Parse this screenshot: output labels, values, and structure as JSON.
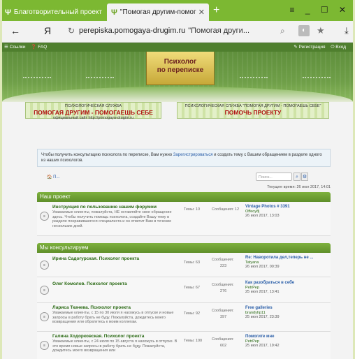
{
  "browser": {
    "tabs": [
      {
        "label": "Благотворительный проект"
      },
      {
        "label": "\"Помогая другим-помог"
      }
    ],
    "url_domain": "perepiska.pomogaya-drugim.ru",
    "url_title": "\"Помогая други..."
  },
  "topnav": {
    "links_label": "Ссылки",
    "faq_label": "FAQ",
    "register_label": "Регистрация",
    "login_label": "Вход"
  },
  "header": {
    "logo_line1": "Психолог",
    "logo_line2": "по переписке"
  },
  "banners": {
    "b1_small": "ПСИХОЛОГИЧЕСКАЯ СЛУЖБА",
    "b1_big": "ПОМОГАЯ ДРУГИМ - ПОМОГАЕШЬ СЕБЕ",
    "b1_site": "официальный сайт http://pomogaya-drugim.ru",
    "b2_small": "ПСИХОЛОГИЧЕСКАЯ СЛУЖБА \"ПОМОГАЯ ДРУГИМ - ПОМОГАЕШЬ СЕБЕ\"",
    "b2_big": "ПОМОЧЬ ПРОЕКТУ"
  },
  "notice": {
    "text_before": "Чтобы получить консультацию психолога по переписке, Вам нужно ",
    "link": "Зарегистрироваться",
    "text_after": " и создать тему с Вашим обращением в разделе одного из наших психологов."
  },
  "breadcrumb": {
    "home_label": "П..."
  },
  "search": {
    "placeholder": "Поиск..."
  },
  "time": "Текущее время: 26 июл 2017, 14:01",
  "sections": [
    {
      "title": "Наш проект",
      "forums": [
        {
          "title": "Инструкция по пользованию нашим форумом",
          "desc": "Уважаемые клиенты, пожалуйста, НЕ оставляйте свое обращение здесь. Чтобы получить помощь психолога, создайте Вашу тему в разделе понравившегося специалиста и он ответит Вам в течение нескольких дней.",
          "topics": "Темы: 10",
          "posts": "Сообщения: 12",
          "last_title": "Vintage Photos # 3391",
          "last_user": "Offeoy8j",
          "last_date": "26 июл 2017, 13:03"
        }
      ]
    },
    {
      "title": "Мы консультируем",
      "forums": [
        {
          "title": "Ирина Садогурская. Психолог проекта",
          "desc": "",
          "topics": "Темы: 63",
          "posts": "Сообщения:",
          "posts_n": "223",
          "last_title": "Re: Наворотила дел,теперь не ...",
          "last_user": "Tatyana",
          "last_date": "26 июл 2017, 00:39"
        },
        {
          "title": "Олег Комолов. Психолог проекта",
          "desc": "",
          "topics": "Темы: 67",
          "posts": "Сообщения:",
          "posts_n": "276",
          "last_title": "Как разобраться в себе",
          "last_user": "PetrPep",
          "last_date": "25 июл 2017, 13:41"
        },
        {
          "title": "Лариса Ткачева. Психолог проекта",
          "desc": "Уважаемые клиенты, с 15 по 30 июля я нахожусь в отпуске и новые запросы в работу брать не буду. Пожалуйста, дождитесь моего возвращения или обратитесь к моим коллегам.",
          "topics": "Темы: 92",
          "posts": "Сообщения:",
          "posts_n": "397",
          "last_title": "Free galleries",
          "last_user": "brandyhp11",
          "last_date": "25 июл 2017, 23:39"
        },
        {
          "title": "Галина Ходорковская. Психолог проекта",
          "desc": "Уважаемые клиенты, с 24 июля по 15 августа я нахожусь в отпуске. В это время новые запросы в работу брать не буду. Пожалуйста, дождитесь моего возвращения или",
          "topics": "Темы: 100",
          "posts": "Сообщения:",
          "posts_n": "602",
          "last_title": "Помогите мне",
          "last_user": "PetrPep",
          "last_date": "25 июл 2017, 19:42"
        }
      ]
    }
  ],
  "colors": {
    "accent": "#7cb832",
    "category": "#6a9e32",
    "link": "#2a5ea8"
  }
}
